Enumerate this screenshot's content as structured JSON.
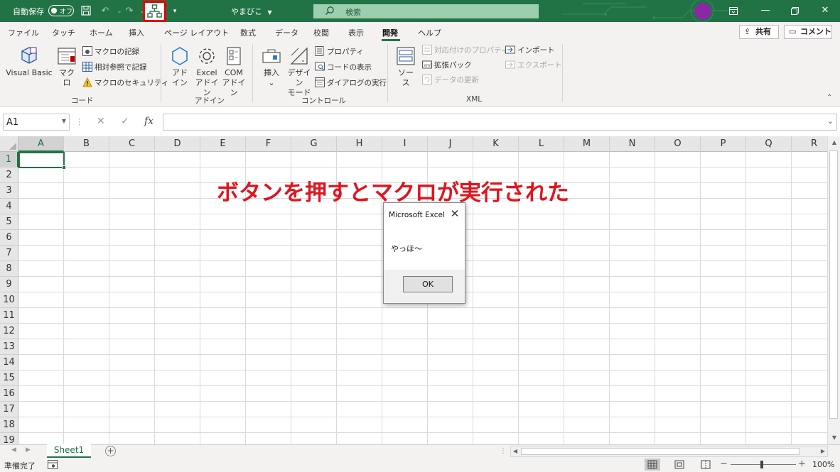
{
  "titlebar": {
    "autosave_label": "自動保存",
    "autosave_state": "オフ",
    "document_name": "やまびこ",
    "search_placeholder": "検索",
    "accent_color": "#217346",
    "highlight_color": "#e60000"
  },
  "tabs": [
    "ファイル",
    "タッチ",
    "ホーム",
    "挿入",
    "ページ レイアウト",
    "数式",
    "データ",
    "校閲",
    "表示",
    "開発",
    "ヘルプ"
  ],
  "active_tab": "開発",
  "share_label": "共有",
  "comment_label": "コメント",
  "ribbon": {
    "code": {
      "group_name": "コード",
      "visual_basic": "Visual Basic",
      "macro": "マクロ",
      "record_macro": "マクロの記録",
      "relative_ref": "相対参照で記録",
      "macro_security": "マクロのセキュリティ"
    },
    "addins": {
      "group_name": "アドイン",
      "addin_line1": "アド",
      "addin_line2": "イン",
      "excel_addin_line1": "Excel",
      "excel_addin_line2": "アドイン",
      "com_addin_line1": "COM",
      "com_addin_line2": "アドイン"
    },
    "controls": {
      "group_name": "コントロール",
      "insert": "挿入",
      "insert_arrow": "⌄",
      "design_mode_line1": "デザイン",
      "design_mode_line2": "モード",
      "properties": "プロパティ",
      "view_code": "コードの表示",
      "run_dialog": "ダイアログの実行"
    },
    "xml": {
      "group_name": "XML",
      "source": "ソース",
      "map_properties": "対応付けのプロパティ",
      "expansion_packs": "拡張パック",
      "refresh_data": "データの更新",
      "import": "インポート",
      "export": "エクスポート"
    }
  },
  "formula_bar": {
    "name_box": "A1",
    "cancel_symbol": "✕",
    "enter_symbol": "✓",
    "fx_symbol": "fx",
    "formula": ""
  },
  "grid": {
    "columns": [
      "A",
      "B",
      "C",
      "D",
      "E",
      "F",
      "G",
      "H",
      "I",
      "J",
      "K",
      "L",
      "M",
      "N",
      "O",
      "P",
      "Q",
      "R"
    ],
    "rows": [
      "1",
      "2",
      "3",
      "4",
      "5",
      "6",
      "7",
      "8",
      "9",
      "10",
      "11",
      "12",
      "13",
      "14",
      "15",
      "16",
      "17",
      "18",
      "19"
    ],
    "selected_cell": "A1"
  },
  "annotation": "ボタンを押すとマクロが実行された",
  "dialog": {
    "title": "Microsoft Excel",
    "close": "✕",
    "message": "やっほ～",
    "ok_label": "OK"
  },
  "sheets": [
    "Sheet1"
  ],
  "add_sheet": "+",
  "statusbar": {
    "ready": "準備完了",
    "zoom": "100%",
    "zoom_minus": "−",
    "zoom_plus": "+"
  }
}
